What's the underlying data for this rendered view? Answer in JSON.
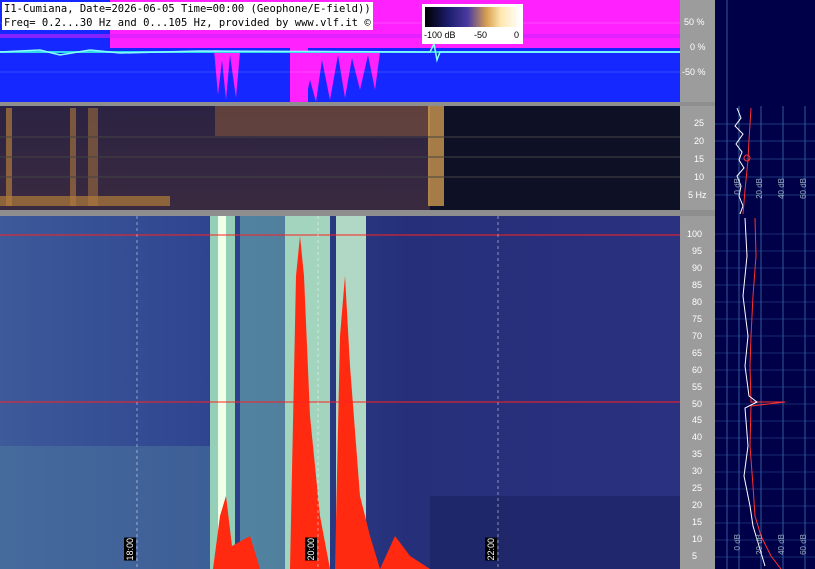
{
  "header": {
    "line1": "I1-Cumiana, Date=2026-06-05 Time=00:00 (Geophone/E-field))",
    "line2": "Freq= 0.2...30 Hz and 0...105 Hz, provided by www.vlf.it ©"
  },
  "colorbar": {
    "labels": [
      "-100 dB",
      "-50",
      "0"
    ]
  },
  "top_panel": {
    "percent_ticks": [
      "50 %",
      "0 %",
      "-50 %"
    ]
  },
  "mid_panel": {
    "hz_ticks": [
      "25",
      "20",
      "15",
      "10",
      "5 Hz"
    ]
  },
  "main_panel": {
    "hz_ticks": [
      "100",
      "95",
      "90",
      "85",
      "80",
      "75",
      "70",
      "65",
      "60",
      "55",
      "50",
      "45",
      "40",
      "35",
      "30",
      "25",
      "20",
      "15",
      "10",
      "5"
    ],
    "time_marks": [
      "18:00",
      "20:00",
      "22:00"
    ]
  },
  "side_plots": {
    "upper_axis_labels": [
      "0 dB",
      "20 dB",
      "40 dB",
      "60 dB",
      "80 dB"
    ],
    "lower_axis_labels": [
      "0 dB",
      "20 dB",
      "40 dB",
      "60 dB",
      "80 dB"
    ]
  },
  "colors": {
    "top_bg": "#1428ff",
    "magenta": "#ff22ff",
    "cyan_trace": "#2fd7e8",
    "grey_band": "#8e8e8e",
    "main_bg": "#2a3483",
    "red_line": "#ff2020",
    "panel_side": "#000048"
  }
}
